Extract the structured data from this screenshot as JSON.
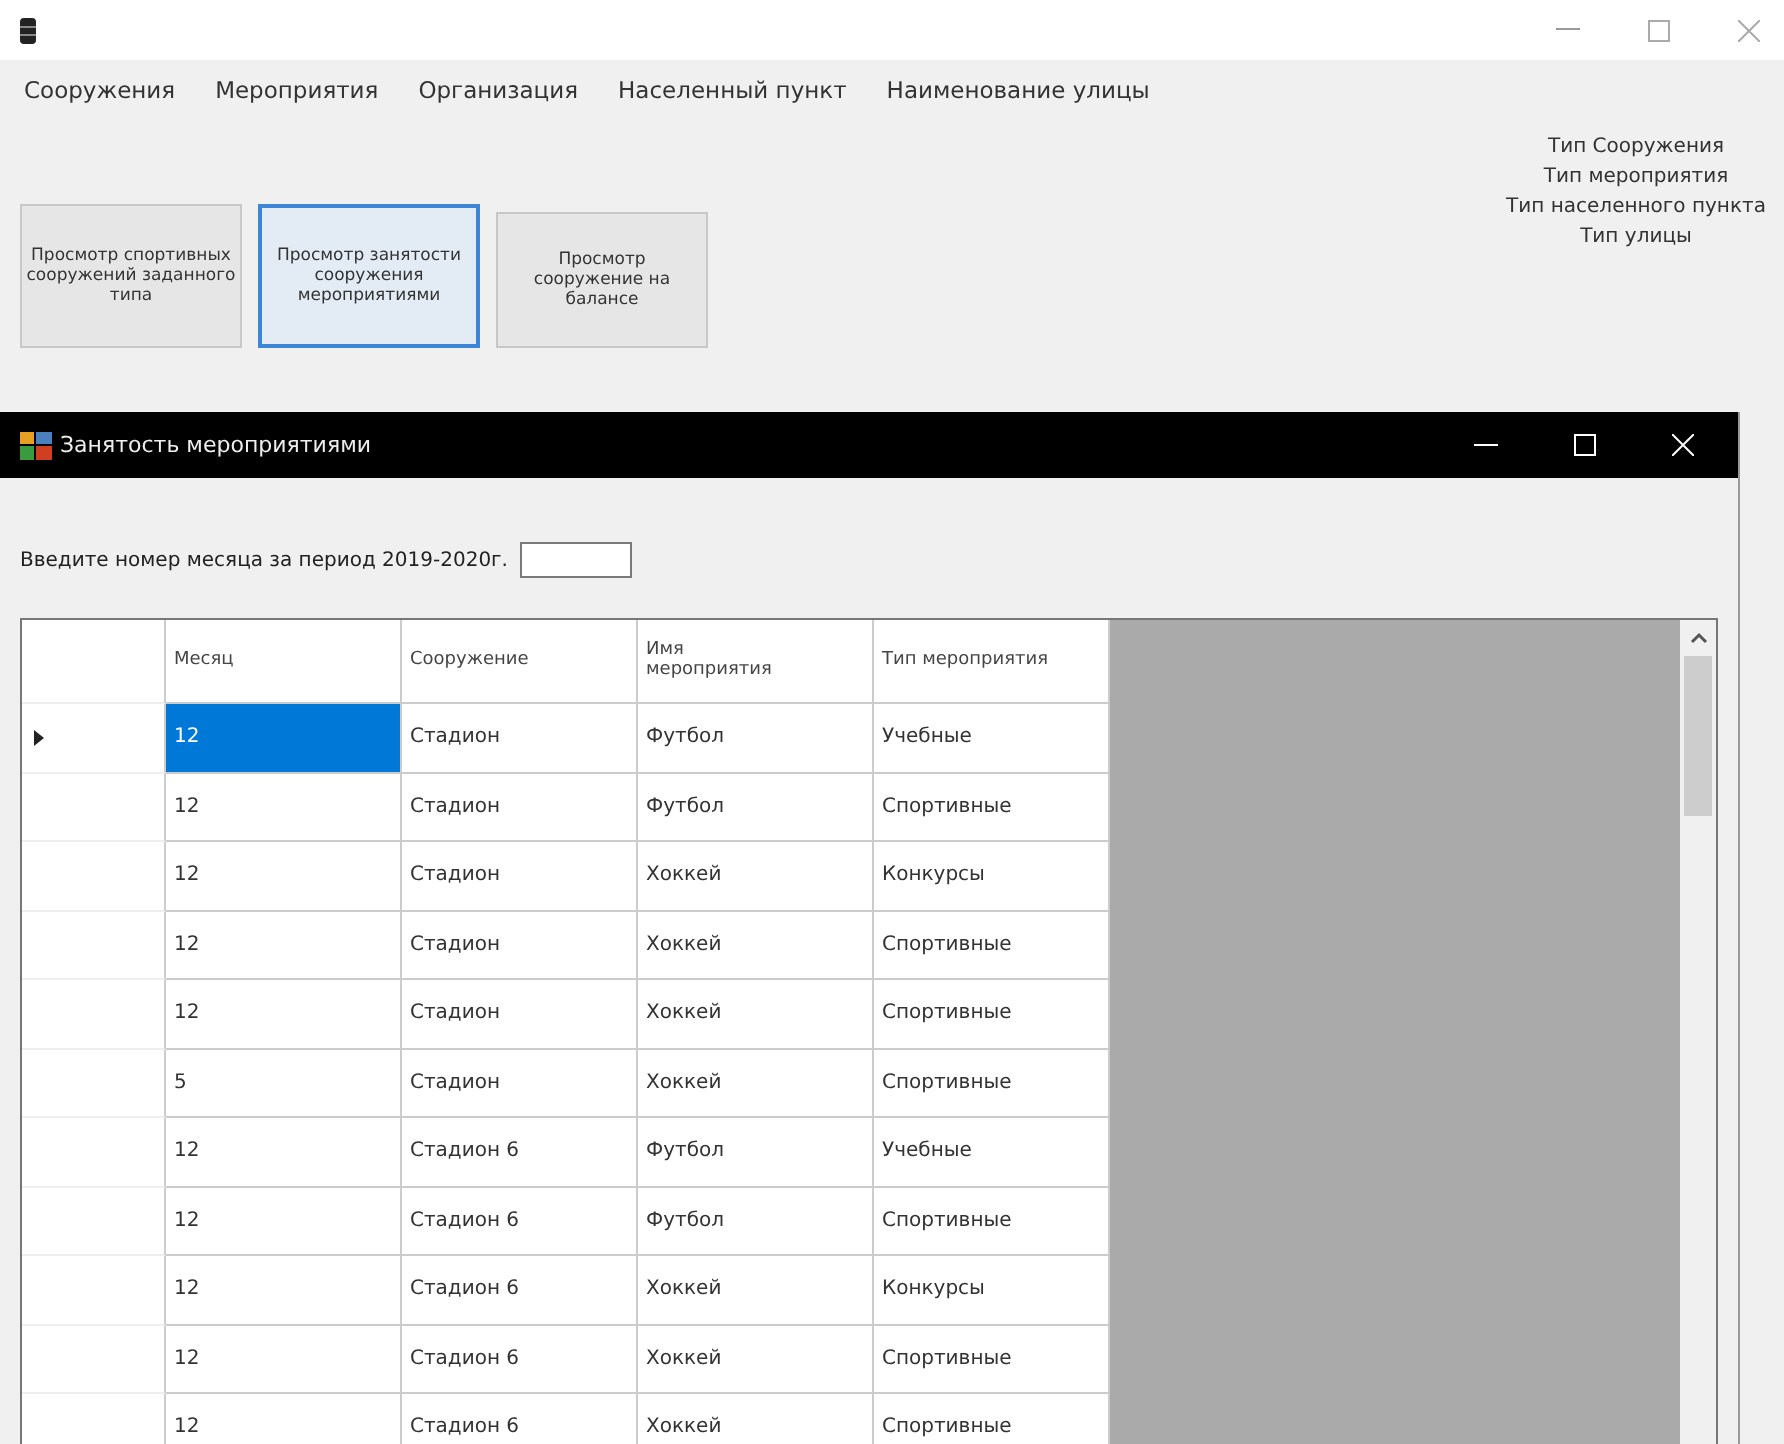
{
  "menu": [
    {
      "label": "Сооружения"
    },
    {
      "label": "Мероприятия"
    },
    {
      "label": "Организация"
    },
    {
      "label": "Населенный пункт"
    },
    {
      "label": "Наименование улицы"
    }
  ],
  "buttons": [
    {
      "label": "Просмотр спортивных сооружений заданного типа",
      "focused": false
    },
    {
      "label": "Просмотр занятости сооружения мероприятиями",
      "focused": true
    },
    {
      "label": "Просмотр сооружение на балансе",
      "focused": false
    }
  ],
  "type_links": [
    "Тип Сооружения",
    "Тип мероприятия",
    "Тип населенного пункта",
    "Тип улицы"
  ],
  "child_window": {
    "title": "Занятость мероприятиями",
    "prompt": "Введите номер месяца за период 2019-2020г.",
    "table": {
      "columns": [
        "Месяц",
        "Сооружение",
        "Имя мероприятия",
        "Тип мероприятия"
      ],
      "rows": [
        {
          "cells": [
            "12",
            "Стадион",
            "Футбол",
            "Учебные"
          ],
          "selected": true
        },
        {
          "cells": [
            "12",
            "Стадион",
            "Футбол",
            "Спортивные"
          ],
          "selected": false
        },
        {
          "cells": [
            "12",
            "Стадион",
            "Хоккей",
            "Конкурсы"
          ],
          "selected": false
        },
        {
          "cells": [
            "12",
            "Стадион",
            "Хоккей",
            "Спортивные"
          ],
          "selected": false
        },
        {
          "cells": [
            "12",
            "Стадион",
            "Хоккей",
            "Спортивные"
          ],
          "selected": false
        },
        {
          "cells": [
            "5",
            "Стадион",
            "Хоккей",
            "Спортивные"
          ],
          "selected": false
        },
        {
          "cells": [
            "12",
            "Стадион 6",
            "Футбол",
            "Учебные"
          ],
          "selected": false
        },
        {
          "cells": [
            "12",
            "Стадион 6",
            "Футбол",
            "Спортивные"
          ],
          "selected": false
        },
        {
          "cells": [
            "12",
            "Стадион 6",
            "Хоккей",
            "Конкурсы"
          ],
          "selected": false
        },
        {
          "cells": [
            "12",
            "Стадион 6",
            "Хоккей",
            "Спортивные"
          ],
          "selected": false
        },
        {
          "cells": [
            "12",
            "Стадион 6",
            "Хоккей",
            "Спортивные"
          ],
          "selected": false
        }
      ]
    }
  }
}
